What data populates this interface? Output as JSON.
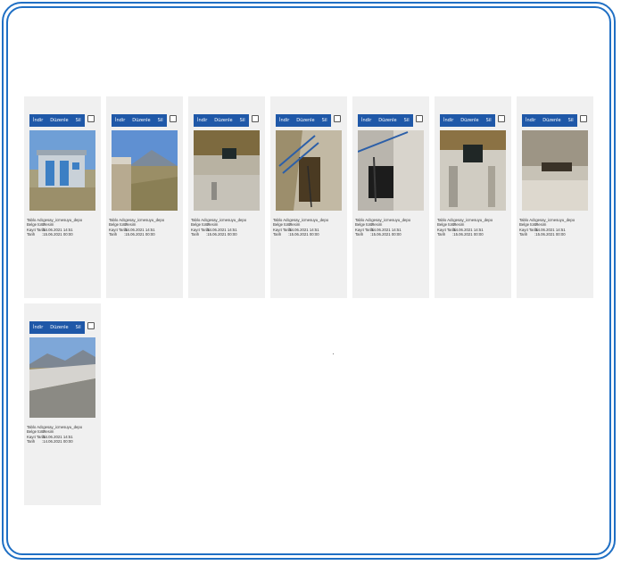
{
  "buttons": {
    "download": "İndir",
    "edit": "Düzenle",
    "delete": "Sil"
  },
  "labels": {
    "table_name": "Tablo Adı",
    "doc_type": "Belge türü",
    "record_date": "Kayıt Tarihi",
    "date": "Tarih"
  },
  "colors": {
    "frame": "#1f6fc4",
    "button_bar": "#1f58a8",
    "card_bg": "#f0f0f0"
  },
  "cards": [
    {
      "table_name": ":gesay_icmesuyu_depo",
      "doc_type": ":Resim",
      "record_date": ":14.06.2021 14:51",
      "date": ":15.06.2021 00:00",
      "photo": "building"
    },
    {
      "table_name": ":gesay_icmesuyu_depo",
      "doc_type": ":Resim",
      "record_date": ":14.06.2021 14:51",
      "date": ":15.06.2021 00:00",
      "photo": "landscape"
    },
    {
      "table_name": ":gesay_icmesuyu_depo",
      "doc_type": ":Resim",
      "record_date": ":14.06.2021 14:51",
      "date": ":15.06.2021 00:00",
      "photo": "tank-interior"
    },
    {
      "table_name": ":gesay_icmesuyu_depo",
      "doc_type": ":Resim",
      "record_date": ":14.06.2021 14:51",
      "date": ":15.06.2021 00:00",
      "photo": "tank-ladder"
    },
    {
      "table_name": ":gesay_icmesuyu_depo",
      "doc_type": ":Resim",
      "record_date": ":14.06.2021 14:51",
      "date": ":15.06.2021 00:00",
      "photo": "tank-pipes"
    },
    {
      "table_name": ":gesay_icmesuyu_depo",
      "doc_type": ":Resim",
      "record_date": ":14.06.2021 14:51",
      "date": ":15.06.2021 00:00",
      "photo": "tank-wall"
    },
    {
      "table_name": ":gesay_icmesuyu_depo",
      "doc_type": ":Resim",
      "record_date": ":14.06.2021 14:51",
      "date": ":15.06.2021 00:00",
      "photo": "tank-floor"
    },
    {
      "table_name": ":gesay_icmesuyu_depo",
      "doc_type": ":Resim",
      "record_date": ":14.06.2021 14:51",
      "date": ":14.06.2021 00:00",
      "photo": "roof-mountains"
    }
  ]
}
